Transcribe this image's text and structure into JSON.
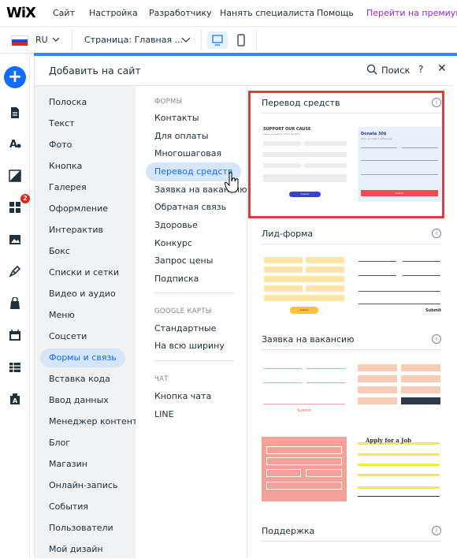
{
  "topbar": {
    "logo": "WiX",
    "menu": [
      "Сайт",
      "Настройка",
      "Разработчику",
      "Нанять специалиста",
      "Помощь"
    ],
    "premium": "Перейти на премиум"
  },
  "secondbar": {
    "language": "RU",
    "page_label": "Страница: Главная ...",
    "devices": [
      "desktop-icon",
      "mobile-icon"
    ]
  },
  "leftbar": {
    "add_label": "+",
    "badge_count": "2",
    "icons": [
      "pages-icon",
      "theme-icon",
      "background-icon",
      "apps-icon",
      "media-icon",
      "pen-icon",
      "store-icon",
      "bookings-icon",
      "table-icon",
      "translate-icon"
    ]
  },
  "panel": {
    "title": "Добавить на сайт",
    "search_label": "Поиск",
    "help": "?",
    "close": "✕"
  },
  "categories": [
    "Полоска",
    "Текст",
    "Фото",
    "Кнопка",
    "Галерея",
    "Оформление",
    "Интерактив",
    "Бокс",
    "Списки и сетки",
    "Видео и аудио",
    "Меню",
    "Соцсети",
    "Формы и связь",
    "Вставка кода",
    "Ввод данных",
    "Менеджер контента",
    "Блог",
    "Магазин",
    "Онлайн-запись",
    "События",
    "Пользователи",
    "Мой дизайн"
  ],
  "active_category": "Формы и связь",
  "subsections": {
    "forms_head": "ФОРМЫ",
    "forms": [
      "Контакты",
      "Для оплаты",
      "Многошаговая",
      "Перевод средств",
      "Заявка на вакансию",
      "Обратная связь",
      "Здоровье",
      "Конкурс",
      "Запрос цены",
      "Подписка"
    ],
    "maps_head": "GOOGLE КАРТЫ",
    "maps": [
      "Стандартные",
      "На всю ширину"
    ],
    "chat_head": "ЧАТ",
    "chat": [
      "Кнопка чата",
      "LINE"
    ]
  },
  "preview": {
    "sections": [
      "Перевод средств",
      "Лид-форма",
      "Заявка на вакансию",
      "Поддержка"
    ],
    "info": "i",
    "donation": {
      "left_title": "SUPPORT OUR CAUSE",
      "left_sub": "Leave a medium-2015 donation",
      "left_btn": "Submit",
      "right_title": "Donate 30$",
      "right_sub": "Help us make a difference",
      "right_btn": "Submit"
    },
    "lead": {
      "button": "Submit",
      "submit_text": "Submit"
    },
    "job": {
      "submit": "Submit",
      "apply_title": "Apply for a Job"
    }
  },
  "colors": {
    "accent": "#116dff",
    "active_bg": "#d5e6fb",
    "premium": "#9a27d5",
    "highlight": "#e13a3a",
    "badge": "#e62214"
  }
}
